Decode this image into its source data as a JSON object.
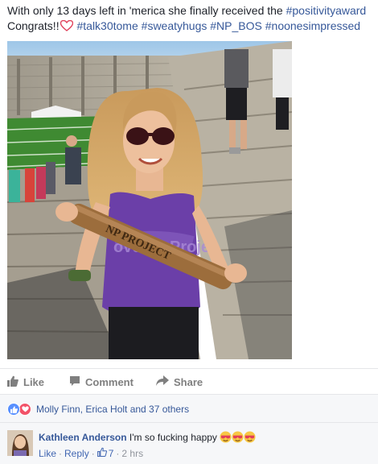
{
  "post": {
    "text_line1_prefix": "With only 13 days left in 'merica she finally received the ",
    "tag_positivityaward": "#positivityaward",
    "text_congrats": "Congrats!!",
    "tag_talk30tome": "#talk30tome",
    "tag_sweatyhugs": "#sweatyhugs",
    "tag_np_bos": "#NP_BOS",
    "tag_noonesimpressed": "#noonesimpressed"
  },
  "photo": {
    "baton_text": "NP PROJECT",
    "shirt_text": "ovemb Projec"
  },
  "actions": {
    "like_label": "Like",
    "comment_label": "Comment",
    "share_label": "Share"
  },
  "reactions": {
    "icons": [
      "like-icon",
      "love-icon"
    ],
    "summary": "Molly Finn, Erica Holt and 37 others"
  },
  "comment": {
    "author": "Kathleen Anderson",
    "text": "I'm so fucking happy",
    "emoji": [
      "heart-eyes-sunglasses-emoji",
      "heart-eyes-sunglasses-emoji",
      "heart-eyes-sunglasses-emoji"
    ],
    "like_label": "Like",
    "reply_label": "Reply",
    "like_count": "7",
    "time": "2 hrs",
    "separator": "·"
  },
  "colors": {
    "link_blue": "#365899",
    "meta_gray": "#90949c",
    "action_gray": "#7f7f7f",
    "like_blue": "#5890ff",
    "love_red": "#f25268",
    "panel_bg": "#f6f7f9"
  }
}
